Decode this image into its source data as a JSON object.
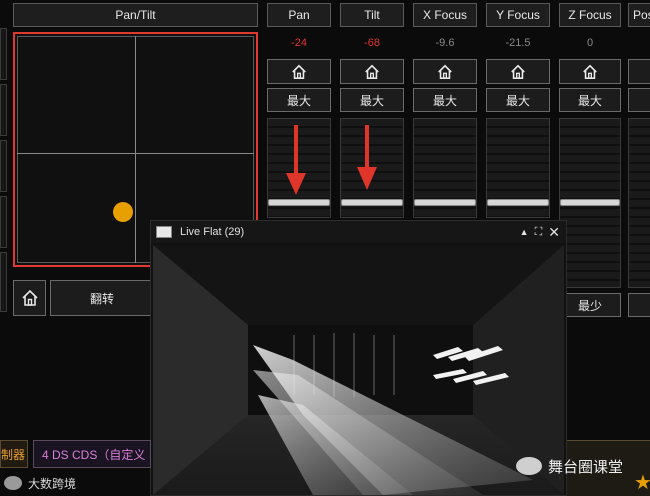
{
  "pantilt": {
    "header": "Pan/Tilt",
    "flip_label": "翻转",
    "home_icon": "home-icon"
  },
  "channels": [
    {
      "name": "Pan",
      "value": "-24",
      "max_label": "最大",
      "value_color": "#e0352b"
    },
    {
      "name": "Tilt",
      "value": "-68",
      "max_label": "最大",
      "value_color": "#e0352b"
    },
    {
      "name": "X Focus",
      "value": "-9.6",
      "max_label": "最大",
      "value_color": "#8a8a8a"
    },
    {
      "name": "Y Focus",
      "value": "-21.5",
      "max_label": "最大",
      "value_color": "#8a8a8a"
    },
    {
      "name": "Z Focus",
      "value": "0",
      "max_label": "最大",
      "value_color": "#8a8a8a",
      "min_label": "最少"
    },
    {
      "name": "Pos"
    }
  ],
  "live_window": {
    "title": "Live Flat (29)"
  },
  "bottom_tabs": {
    "left_tab": "制器",
    "cds_tab": "4 DS  CDS（自定义"
  },
  "watermarks": {
    "left": "大数跨境",
    "right": "舞台圈课堂"
  },
  "colors": {
    "accent_red": "#e03a30",
    "pad_dot": "#e7a000",
    "arrow_red": "#e0352b"
  }
}
